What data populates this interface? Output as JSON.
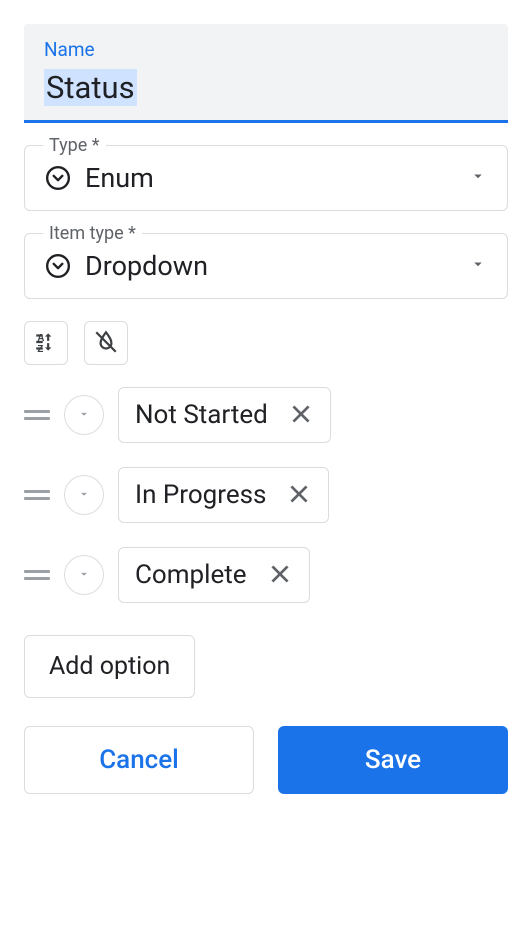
{
  "name_field": {
    "label": "Name",
    "value": "Status"
  },
  "type_field": {
    "label": "Type *",
    "value": "Enum"
  },
  "item_type_field": {
    "label": "Item type *",
    "value": "Dropdown"
  },
  "options": [
    {
      "label": "Not Started"
    },
    {
      "label": "In Progress"
    },
    {
      "label": "Complete"
    }
  ],
  "buttons": {
    "add_option": "Add option",
    "cancel": "Cancel",
    "save": "Save"
  },
  "icons": {
    "sort": "sort-az-icon",
    "color_off": "color-off-icon"
  }
}
